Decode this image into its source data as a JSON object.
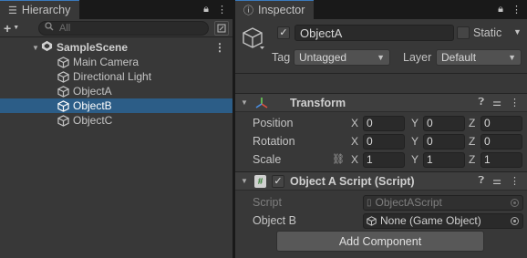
{
  "hierarchy": {
    "tab_label": "Hierarchy",
    "add_label": "+",
    "search_placeholder": "All",
    "scene": {
      "name": "SampleScene",
      "menu_glyph": "⋮"
    },
    "items": [
      {
        "label": "Main Camera",
        "selected": false
      },
      {
        "label": "Directional Light",
        "selected": false
      },
      {
        "label": "ObjectA",
        "selected": false
      },
      {
        "label": "ObjectB",
        "selected": true
      },
      {
        "label": "ObjectC",
        "selected": false
      }
    ]
  },
  "inspector": {
    "tab_label": "Inspector",
    "object": {
      "name": "ObjectA",
      "active": true,
      "static_label": "Static",
      "static_checked": false,
      "tag_label": "Tag",
      "tag_value": "Untagged",
      "layer_label": "Layer",
      "layer_value": "Default"
    },
    "transform": {
      "title": "Transform",
      "rows": [
        {
          "label": "Position",
          "x": "0",
          "y": "0",
          "z": "0"
        },
        {
          "label": "Rotation",
          "x": "0",
          "y": "0",
          "z": "0"
        },
        {
          "label": "Scale",
          "x": "1",
          "y": "1",
          "z": "1"
        }
      ],
      "axis_labels": {
        "x": "X",
        "y": "Y",
        "z": "Z"
      }
    },
    "script_component": {
      "title": "Object A Script (Script)",
      "enabled": true,
      "script_label": "Script",
      "script_value": "ObjectAScript",
      "field_label": "Object B",
      "field_value": "None (Game Object)"
    },
    "add_component_label": "Add Component"
  },
  "colors": {
    "panel_bg": "#383838",
    "selection": "#2c5d87",
    "tab_accent": "#3a79bb"
  }
}
